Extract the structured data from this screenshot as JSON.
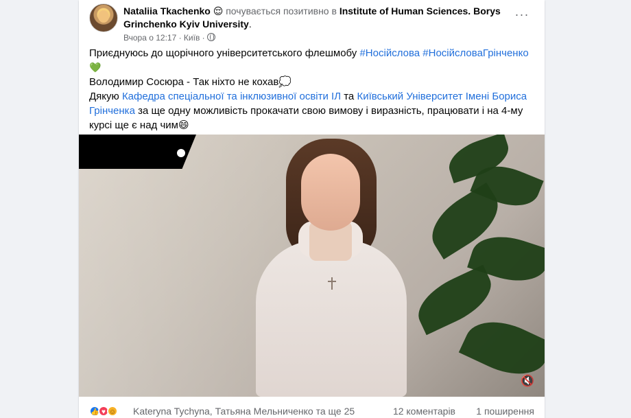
{
  "post": {
    "author": "Nataliia Tkachenko",
    "feeling_emoji": "😌",
    "feeling_text": "почувається позитивно в",
    "place": "Institute of Human Sciences. Borys Grinchenko Kyiv University",
    "time": "Вчора о 12:17",
    "location": "Київ",
    "more_label": "···"
  },
  "content": {
    "line1_prefix": "Приєднуюсь до щорічного університетського флешмобу",
    "hashtag1": "#Носійслова",
    "hashtag2": "#НосійсловаГрінченко",
    "heart": "💚",
    "line2": "Володимир Сосюра - Так ніхто не кохав💭",
    "line3_prefix": "Дякую",
    "link1": "Кафедра спеціальної та інклюзивної освіти ІЛ",
    "line3_mid": "та",
    "link2": "Київський Університет Імені Бориса Грінченка",
    "line3_suffix": "за ще одну можливість прокачати свою вимову і виразність, працювати і на 4-му курсі ще є над чим😄"
  },
  "video": {
    "mute_label": "🔇"
  },
  "footer": {
    "reactors": "Kateryna Tychyna, Татьяна Мельниченко та ще 25",
    "comments": "12 коментарів",
    "shares": "1 поширення"
  }
}
